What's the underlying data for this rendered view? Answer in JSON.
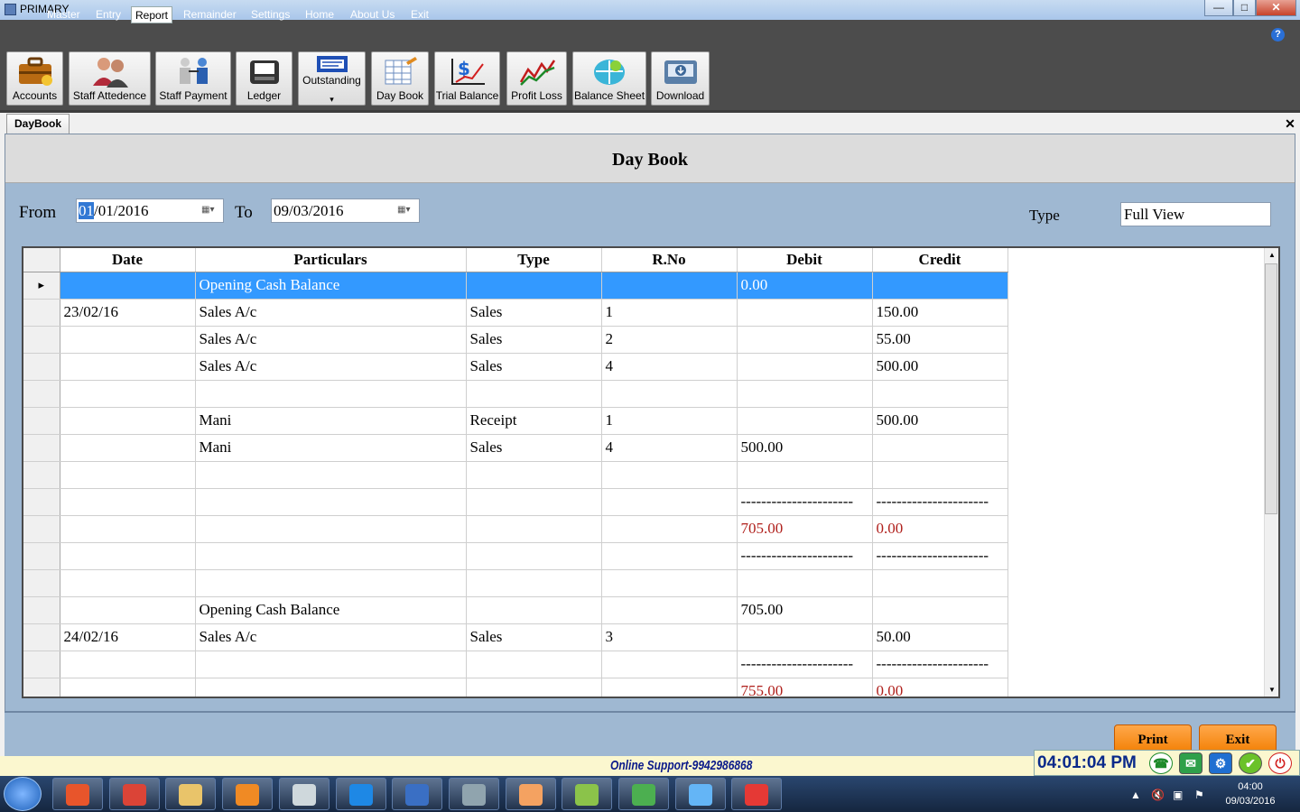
{
  "window": {
    "title": "PRIMARY",
    "min": "—",
    "max": "□",
    "close": "✕"
  },
  "menu": [
    "Master",
    "Entry",
    "Report",
    "Remainder",
    "Settings",
    "Home",
    "About Us",
    "Exit"
  ],
  "help_icon": "?",
  "toolbar": [
    {
      "label": "Accounts",
      "icon": "briefcase-icon"
    },
    {
      "label": "Staff Attedence",
      "icon": "people-icon"
    },
    {
      "label": "Staff Payment",
      "icon": "payment-icon"
    },
    {
      "label": "Ledger",
      "icon": "ledger-icon"
    },
    {
      "label": "Outstanding",
      "icon": "outstanding-icon"
    },
    {
      "label": "Day Book",
      "icon": "daybook-icon"
    },
    {
      "label": "Trial Balance",
      "icon": "trial-balance-icon"
    },
    {
      "label": "Profit  Loss",
      "icon": "profit-loss-icon"
    },
    {
      "label": "Balance Sheet",
      "icon": "balance-sheet-icon"
    },
    {
      "label": "Download",
      "icon": "download-icon"
    }
  ],
  "outstanding_arrow": "▾",
  "tab": "DayBook",
  "doc_close": "✕",
  "page_title": "Day Book",
  "filters": {
    "from_label": "From",
    "from_sel": "01",
    "from_rest": "/01/2016",
    "to_label": "To",
    "to_value": "09/03/2016",
    "type_label": "Type",
    "type_value": "Full View",
    "calendar_glyph": "▦▾"
  },
  "grid": {
    "columns": [
      "Date",
      "Particulars",
      "Type",
      "R.No",
      "Debit",
      "Credit"
    ],
    "row_marker": "▸",
    "rows": [
      {
        "date": "",
        "particulars": "Opening Cash Balance",
        "type": "",
        "rno": "",
        "debit": "0.00",
        "credit": "",
        "selected": true
      },
      {
        "date": "23/02/16",
        "particulars": "Sales A/c",
        "type": "Sales",
        "rno": "1",
        "debit": "",
        "credit": "150.00"
      },
      {
        "date": "",
        "particulars": "Sales A/c",
        "type": "Sales",
        "rno": "2",
        "debit": "",
        "credit": "55.00"
      },
      {
        "date": "",
        "particulars": "Sales A/c",
        "type": "Sales",
        "rno": "4",
        "debit": "",
        "credit": "500.00"
      },
      {
        "date": "",
        "particulars": "",
        "type": "",
        "rno": "",
        "debit": "",
        "credit": ""
      },
      {
        "date": "",
        "particulars": "Mani",
        "type": "Receipt",
        "rno": "1",
        "debit": "",
        "credit": "500.00"
      },
      {
        "date": "",
        "particulars": "Mani",
        "type": "Sales",
        "rno": "4",
        "debit": "500.00",
        "credit": ""
      },
      {
        "date": "",
        "particulars": "",
        "type": "",
        "rno": "",
        "debit": "",
        "credit": ""
      },
      {
        "date": "",
        "particulars": "",
        "type": "",
        "rno": "",
        "debit": "----------------------",
        "credit": "----------------------"
      },
      {
        "date": "",
        "particulars": "",
        "type": "",
        "rno": "",
        "debit": "705.00",
        "credit": "0.00",
        "red": true
      },
      {
        "date": "",
        "particulars": "",
        "type": "",
        "rno": "",
        "debit": "----------------------",
        "credit": "----------------------"
      },
      {
        "date": "",
        "particulars": "",
        "type": "",
        "rno": "",
        "debit": "",
        "credit": ""
      },
      {
        "date": "",
        "particulars": "Opening Cash Balance",
        "type": "",
        "rno": "",
        "debit": "705.00",
        "credit": ""
      },
      {
        "date": "24/02/16",
        "particulars": "Sales A/c",
        "type": "Sales",
        "rno": "3",
        "debit": "",
        "credit": "50.00"
      },
      {
        "date": "",
        "particulars": "",
        "type": "",
        "rno": "",
        "debit": "----------------------",
        "credit": "----------------------"
      },
      {
        "date": "",
        "particulars": "",
        "type": "",
        "rno": "",
        "debit": "755.00",
        "credit": "0.00",
        "red": true
      }
    ]
  },
  "buttons": {
    "print": "Print",
    "exit": "Exit"
  },
  "support": "Online Support-9942986868",
  "clock": "04:01:04 PM",
  "status_icons": [
    "☎",
    "✉",
    "⚙",
    "✔",
    "⏻"
  ],
  "taskbar": {
    "apps": [
      "media-player-icon",
      "chrome-icon",
      "file-explorer-icon",
      "app-icon",
      "notepad-icon",
      "teamviewer-icon",
      "network-icon",
      "calculator-icon",
      "paint-icon",
      "snipping-icon",
      "terminal-icon",
      "remote-desktop-icon",
      "windows-app-icon"
    ],
    "tray_time": "04:00",
    "tray_date": "09/03/2016"
  },
  "colors": {
    "selected_row": "#3399ff",
    "red_total": "#b0201c",
    "orange_button": "#f27d00",
    "panel": "#9fb8d2"
  }
}
